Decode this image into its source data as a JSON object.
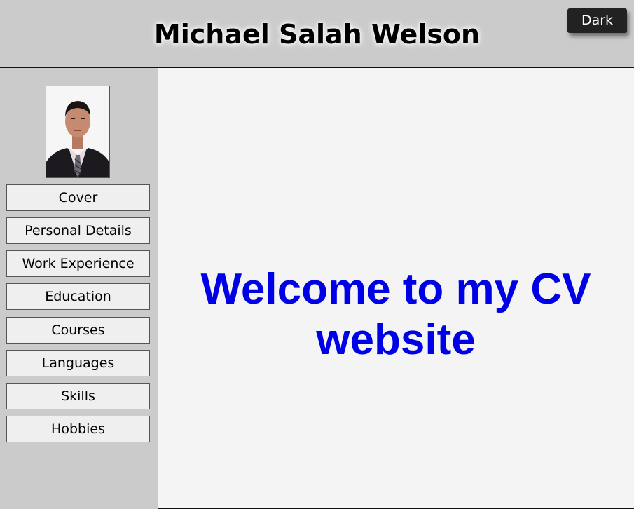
{
  "header": {
    "title": "Michael Salah Welson",
    "theme_toggle_label": "Dark"
  },
  "sidebar": {
    "photo_alt": "Profile photo",
    "items": [
      {
        "label": "Cover"
      },
      {
        "label": "Personal Details"
      },
      {
        "label": "Work Experience"
      },
      {
        "label": "Education"
      },
      {
        "label": "Courses"
      },
      {
        "label": "Languages"
      },
      {
        "label": "Skills"
      },
      {
        "label": "Hobbies"
      }
    ]
  },
  "main": {
    "welcome_line1": "Welcome to my CV",
    "welcome_line2": "website"
  },
  "colors": {
    "background": "#cbcbcb",
    "content_background": "#f4f4f4",
    "welcome_text": "#0000e6",
    "dark_button": "#222222"
  }
}
